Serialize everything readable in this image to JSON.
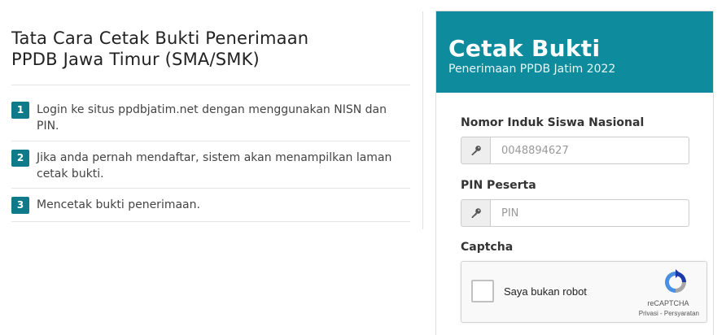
{
  "guide": {
    "title_line1": "Tata Cara Cetak Bukti Penerimaan",
    "title_line2": "PPDB Jawa Timur (SMA/SMK)",
    "steps": [
      {
        "number": "1",
        "text": "Login ke situs ppdbjatim.net dengan menggunakan NISN dan PIN."
      },
      {
        "number": "2",
        "text": "Jika anda pernah mendaftar, sistem akan menampilkan laman cetak bukti."
      },
      {
        "number": "3",
        "text": "Mencetak bukti penerimaan."
      }
    ]
  },
  "panel": {
    "title": "Cetak Bukti",
    "subtitle": "Penerimaan PPDB Jatim 2022",
    "accent_color": "#0e8b9c"
  },
  "form": {
    "nisn": {
      "label": "Nomor Induk Siswa Nasional",
      "placeholder": "0048894627",
      "icon": "key-icon"
    },
    "pin": {
      "label": "PIN Peserta",
      "placeholder": "PIN",
      "icon": "key-icon"
    },
    "captcha": {
      "label": "Captcha",
      "checkbox_text": "Saya bukan robot",
      "brand": "reCAPTCHA",
      "terms": "Privasi - Persyaratan"
    }
  }
}
